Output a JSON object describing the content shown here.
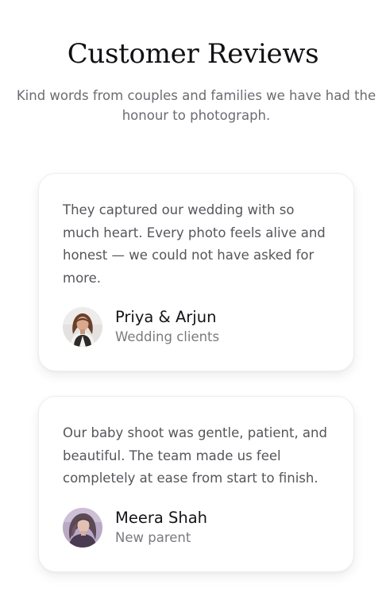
{
  "header": {
    "title": "Customer Reviews",
    "subtitle": "Kind words from couples and families we have had the honour to photograph."
  },
  "reviews": [
    {
      "quote": "They captured our wedding with so much heart. Every photo feels alive and honest — we could not have asked for more.",
      "name": "Priya & Arjun",
      "role": "Wedding clients",
      "avatar_icon": "woman-portrait-avatar"
    },
    {
      "quote": "Our baby shoot was gentle, patient, and beautiful. The team made us feel completely at ease from start to finish.",
      "name": "Meera Shah",
      "role": "New parent",
      "avatar_icon": "woman-portrait-avatar"
    }
  ],
  "colors": {
    "text_primary": "#141418",
    "text_muted": "#6b6b72",
    "card_border": "#eeeef0"
  }
}
